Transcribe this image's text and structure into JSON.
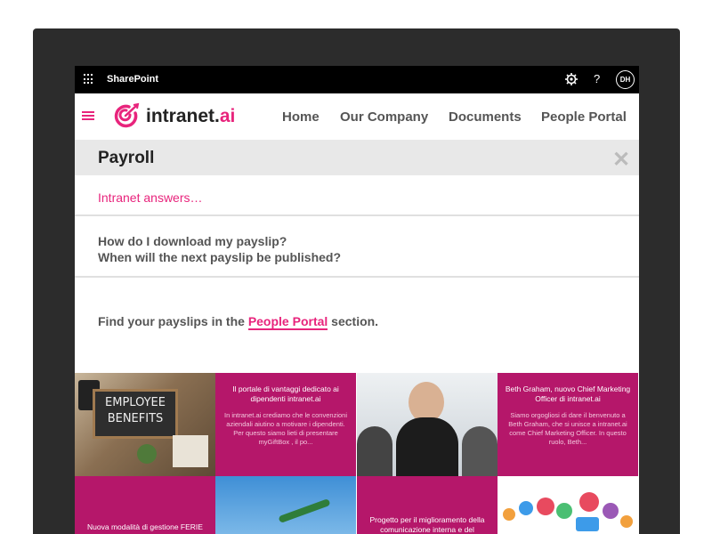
{
  "suitebar": {
    "app_name": "SharePoint",
    "help": "?",
    "avatar_initials": "DH"
  },
  "header": {
    "logo_main": "intranet.",
    "logo_accent": "ai",
    "nav": [
      "Home",
      "Our Company",
      "Documents",
      "People Portal"
    ]
  },
  "panel": {
    "title": "Payroll",
    "close": "✕",
    "answers_label": "Intranet answers…",
    "questions": [
      "How do I download my payslip?",
      "When will the next payslip be published?"
    ],
    "find_prefix": "Find your payslips in the ",
    "find_link": "People Portal",
    "find_suffix": " section."
  },
  "tiles": [
    {
      "image_text_1": "EMPLOYEE",
      "image_text_2": "BENEFITS"
    },
    {
      "title": "Il portale di vantaggi dedicato ai dipendenti intranet.ai",
      "text": "In intranet.ai crediamo che le convenzioni aziendali aiutino a motivare i dipendenti. Per questo siamo lieti di presentare myGiftBox , il po..."
    },
    {},
    {
      "title": "Beth Graham, nuovo Chief Marketing Officer di intranet.ai",
      "text": "Siamo orgogliosi di dare il benvenuto a Beth Graham, che si unisce a intranet.ai come Chief Marketing Officer.  In questo ruolo, Beth..."
    },
    {
      "title": "Nuova modalità di gestione FERIE"
    },
    {},
    {
      "title": "Progetto per il miglioramento della comunicazione interna e del"
    },
    {}
  ],
  "colors": {
    "accent": "#e8247c",
    "tile_pink": "#b5176a",
    "suitebar": "#000000"
  }
}
